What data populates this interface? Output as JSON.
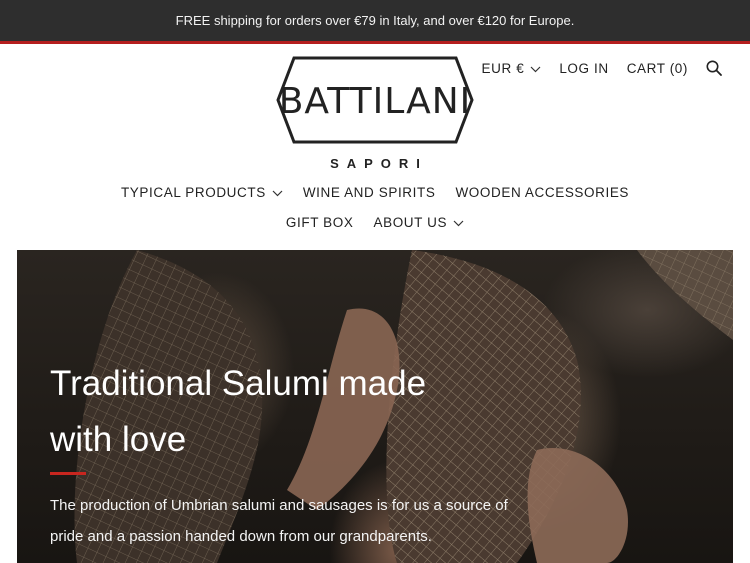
{
  "announcement": {
    "text": "FREE shipping for orders over €79 in Italy, and over €120 for Europe."
  },
  "header": {
    "currency_label": "EUR €",
    "login_label": "LOG IN",
    "cart_label": "CART (0)",
    "logo_text": "BATTILANI",
    "logo_subtitle": "SAPORI"
  },
  "nav": {
    "row1": [
      {
        "label": "TYPICAL PRODUCTS",
        "has_dropdown": true
      },
      {
        "label": "WINE AND SPIRITS",
        "has_dropdown": false
      },
      {
        "label": "WOODEN ACCESSORIES",
        "has_dropdown": false
      }
    ],
    "row2": [
      {
        "label": "GIFT BOX",
        "has_dropdown": false
      },
      {
        "label": "ABOUT US",
        "has_dropdown": true
      }
    ]
  },
  "hero": {
    "title": "Traditional Salumi made with love",
    "text": "The production of Umbrian salumi and sausages is for us a source of pride and a passion handed down from our grandparents."
  },
  "colors": {
    "announcement_bg": "#2e2e2e",
    "accent_red": "#b51f1f"
  }
}
